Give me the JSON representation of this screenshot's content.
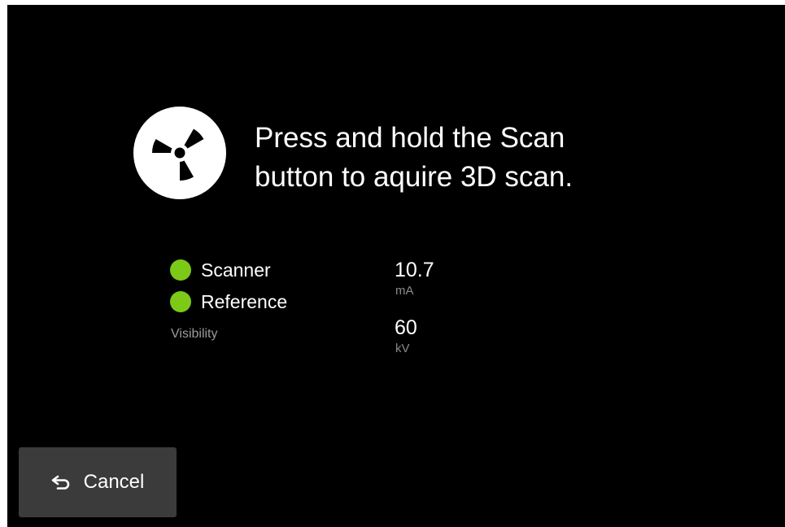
{
  "instruction": {
    "text": "Press and hold the Scan\nbutton  to aquire 3D scan."
  },
  "status": {
    "items": [
      {
        "label": "Scanner",
        "color": "#7cc918"
      },
      {
        "label": "Reference",
        "color": "#7cc918"
      }
    ],
    "visibility_label": "Visibility"
  },
  "readings": {
    "current": {
      "value": "10.7",
      "unit": "mA"
    },
    "voltage": {
      "value": "60",
      "unit": "kV"
    }
  },
  "actions": {
    "cancel_label": "Cancel",
    "cancel_icon": "undo-arrow-icon"
  },
  "icons": {
    "main": "radiation-icon"
  },
  "colors": {
    "background": "#000000",
    "accent": "#7cc918",
    "button": "#3b3b3b"
  }
}
